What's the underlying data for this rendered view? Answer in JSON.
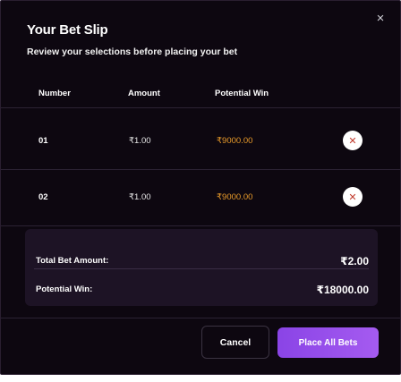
{
  "modal": {
    "title": "Your Bet Slip",
    "subtitle": "Review your selections before placing your bet",
    "close_icon": "×"
  },
  "table": {
    "headers": {
      "number": "Number",
      "amount": "Amount",
      "potential_win": "Potential Win"
    },
    "rows": [
      {
        "number": "01",
        "amount": "₹1.00",
        "potential_win": "₹9000.00",
        "remove_icon": "✕"
      },
      {
        "number": "02",
        "amount": "₹1.00",
        "potential_win": "₹9000.00",
        "remove_icon": "✕"
      }
    ]
  },
  "summary": {
    "total_label": "Total Bet Amount:",
    "total_value": "₹2.00",
    "potential_label": "Potential Win:",
    "potential_value": "₹18000.00"
  },
  "actions": {
    "cancel_label": "Cancel",
    "place_label": "Place All Bets"
  },
  "colors": {
    "background": "#0d0710",
    "win_text": "#e89a2a",
    "accent": "#9b51ee"
  }
}
